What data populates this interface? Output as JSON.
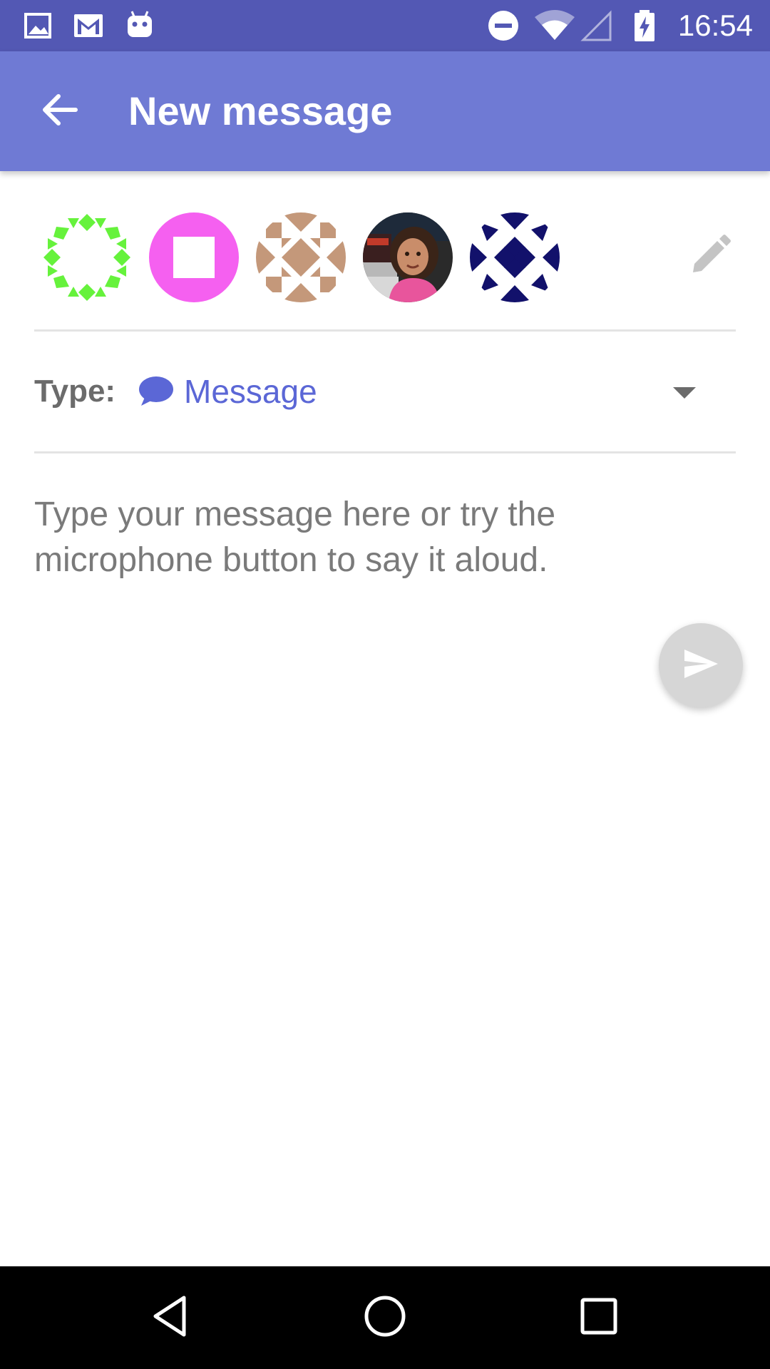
{
  "status_bar": {
    "time": "16:54",
    "icons": [
      "image-notification-icon",
      "gmail-notification-icon",
      "android-notification-icon",
      "do-not-disturb-icon",
      "wifi-icon",
      "cell-signal-icon",
      "battery-charging-icon"
    ]
  },
  "app_bar": {
    "title": "New message",
    "back_icon": "arrow-back-icon"
  },
  "recipients": {
    "avatars": [
      {
        "kind": "pattern",
        "color": "#66f23c"
      },
      {
        "kind": "pattern",
        "color": "#f560f0"
      },
      {
        "kind": "pattern",
        "color": "#c4987a"
      },
      {
        "kind": "photo"
      },
      {
        "kind": "pattern",
        "color": "#12116b"
      }
    ],
    "edit_icon": "pencil-icon"
  },
  "type_selector": {
    "label": "Type:",
    "value": "Message",
    "value_icon": "chat-bubble-icon",
    "dropdown_icon": "dropdown-arrow-icon"
  },
  "compose": {
    "placeholder": "Type your message here or try the microphone button to say it aloud.",
    "value": ""
  },
  "send": {
    "icon": "send-icon"
  },
  "nav_bar": {
    "buttons": [
      "back-triangle-icon",
      "home-circle-icon",
      "recents-square-icon"
    ]
  },
  "colors": {
    "status_bar": "#5358b4",
    "app_bar": "#6f7ad4",
    "accent": "#5b67d6",
    "label_gray": "#6b6b6b",
    "placeholder_gray": "#7a7a7a",
    "divider": "#e4e4e4",
    "fab_disabled": "#d6d6d6",
    "icon_gray": "#c4c4c4"
  }
}
